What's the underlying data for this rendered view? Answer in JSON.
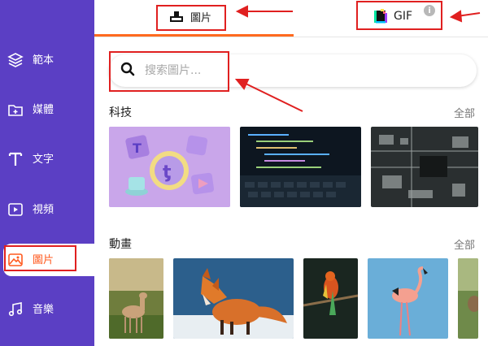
{
  "sidebar": {
    "items": [
      {
        "label": "範本",
        "icon": "layers-icon"
      },
      {
        "label": "媒體",
        "icon": "folder-add-icon"
      },
      {
        "label": "文字",
        "icon": "text-icon"
      },
      {
        "label": "視頻",
        "icon": "play-icon"
      },
      {
        "label": "圖片",
        "icon": "image-icon",
        "active": true
      },
      {
        "label": "音樂",
        "icon": "music-icon"
      }
    ]
  },
  "tabs": [
    {
      "label": "圖片",
      "icon": "image-tab-icon",
      "active": true
    },
    {
      "label": "GIF",
      "icon": "gif-icon"
    }
  ],
  "search": {
    "placeholder": "搜索圖片..."
  },
  "sections": [
    {
      "title": "科技",
      "see_all": "全部"
    },
    {
      "title": "動畫",
      "see_all": "全部"
    }
  ],
  "colors": {
    "sidebar": "#5b3fc4",
    "accent": "#ff6a1f",
    "annotation": "#e02020"
  }
}
